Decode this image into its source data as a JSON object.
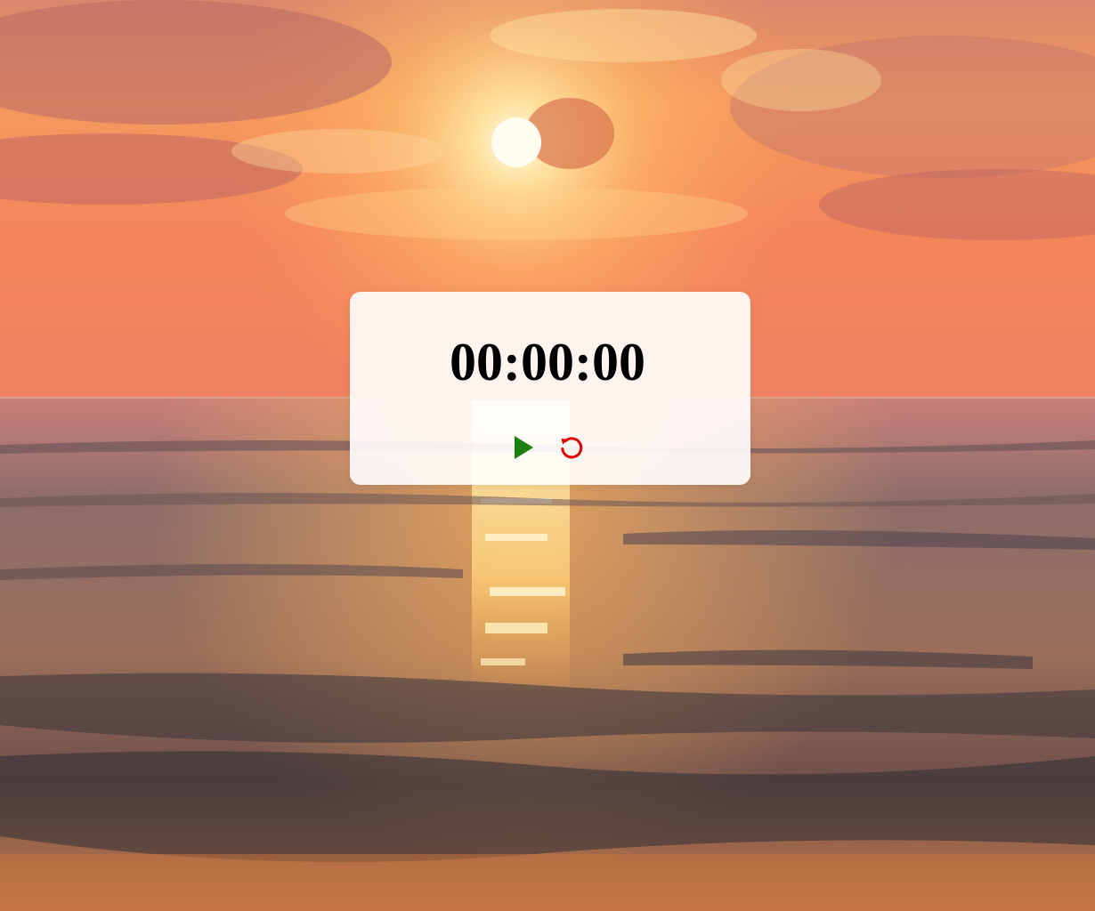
{
  "timer": {
    "display": "00:00:00"
  },
  "controls": {
    "start_icon": "play-icon",
    "reset_icon": "reset-icon"
  },
  "colors": {
    "start": "#1a7f0e",
    "reset": "#e00000",
    "card_background": "#ffffff",
    "time_text": "#000000"
  },
  "background": {
    "scene": "sunset-over-sea"
  }
}
